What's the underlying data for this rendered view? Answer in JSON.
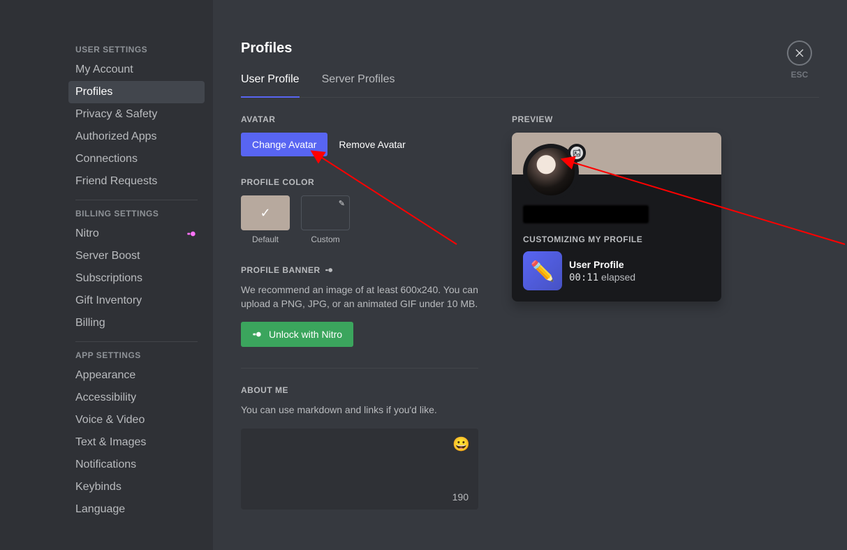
{
  "sidebar": {
    "sections": {
      "user": {
        "header": "USER SETTINGS",
        "items": [
          "My Account",
          "Profiles",
          "Privacy & Safety",
          "Authorized Apps",
          "Connections",
          "Friend Requests"
        ],
        "selected": 1
      },
      "billing": {
        "header": "BILLING SETTINGS",
        "items": [
          "Nitro",
          "Server Boost",
          "Subscriptions",
          "Gift Inventory",
          "Billing"
        ]
      },
      "app": {
        "header": "APP SETTINGS",
        "items": [
          "Appearance",
          "Accessibility",
          "Voice & Video",
          "Text & Images",
          "Notifications",
          "Keybinds",
          "Language"
        ]
      }
    }
  },
  "close": {
    "label": "ESC"
  },
  "page": {
    "title": "Profiles"
  },
  "tabs": {
    "user_profile": "User Profile",
    "server_profiles": "Server Profiles"
  },
  "avatar": {
    "header": "AVATAR",
    "change": "Change Avatar",
    "remove": "Remove Avatar"
  },
  "profile_color": {
    "header": "PROFILE COLOR",
    "default_label": "Default",
    "custom_label": "Custom",
    "default_hex": "#b7a99e"
  },
  "profile_banner": {
    "header": "PROFILE BANNER",
    "help": "We recommend an image of at least 600x240. You can upload a PNG, JPG, or an animated GIF under 10 MB.",
    "unlock": "Unlock with Nitro"
  },
  "about_me": {
    "header": "ABOUT ME",
    "help": "You can use markdown and links if you'd like.",
    "counter": "190"
  },
  "preview": {
    "header": "PREVIEW",
    "customizing": "CUSTOMIZING MY PROFILE",
    "activity_title": "User Profile",
    "elapsed_time": "00:11",
    "elapsed_suffix": " elapsed"
  }
}
